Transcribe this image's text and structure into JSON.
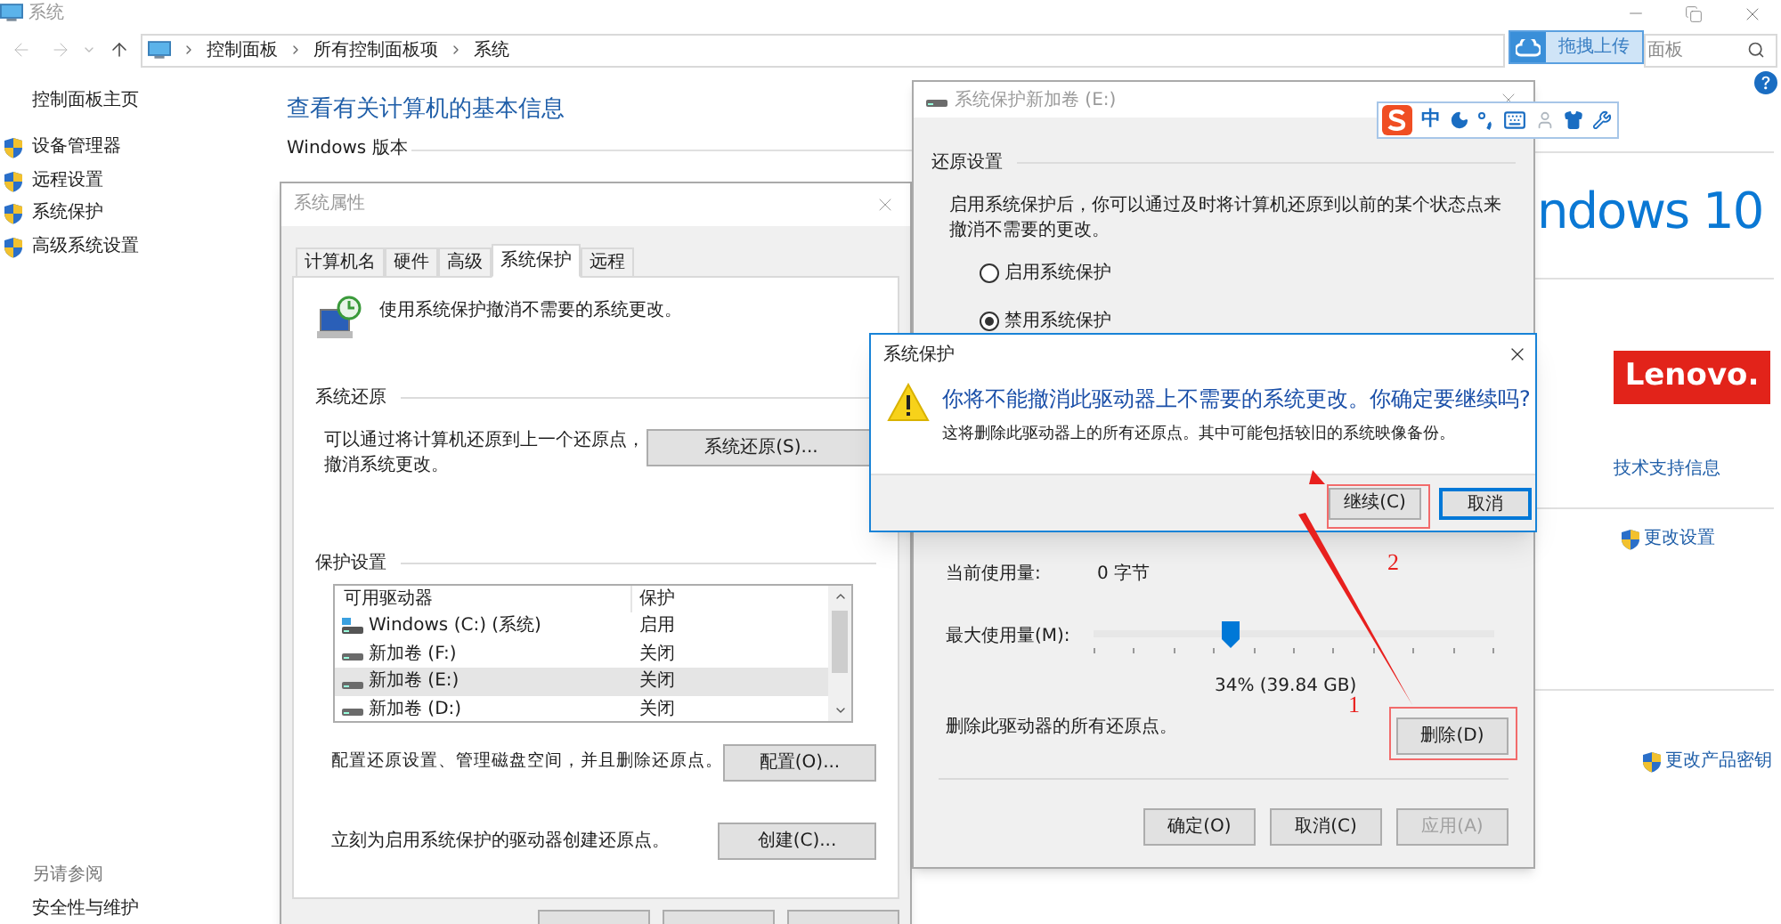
{
  "explorer": {
    "title": "系统",
    "crumbs": [
      "控制面板",
      "所有控制面板项",
      "系统"
    ],
    "search": {
      "placeholder": "面板"
    },
    "sidebar": {
      "home": "控制面板主页",
      "items": [
        "设备管理器",
        "远程设置",
        "系统保护",
        "高级系统设置"
      ],
      "see_also_title": "另请参阅",
      "see_also_items": [
        "安全性与维护"
      ]
    },
    "main": {
      "heading": "查看有关计算机的基本信息",
      "section_label": "Windows 版本",
      "windows_logo": "ndows 10",
      "oem_logo": "Lenovo.",
      "support_link": "技术支持信息",
      "change_settings": "更改设置",
      "change_key": "更改产品密钥"
    }
  },
  "upload_widget": {
    "label": "拖拽上传"
  },
  "system_properties": {
    "title": "系统属性",
    "tabs": [
      {
        "label": "计算机名",
        "selected": false
      },
      {
        "label": "硬件",
        "selected": false
      },
      {
        "label": "高级",
        "selected": false
      },
      {
        "label": "系统保护",
        "selected": true
      },
      {
        "label": "远程",
        "selected": false
      }
    ],
    "intro": "使用系统保护撤消不需要的系统更改。",
    "restore_group": {
      "title": "系统还原",
      "text": "可以通过将计算机还原到上一个还原点，撤消系统更改。",
      "button": "系统还原(S)..."
    },
    "protection_group": {
      "title": "保护设置",
      "columns": [
        "可用驱动器",
        "保护"
      ],
      "rows": [
        {
          "kind": "system",
          "drive": "Windows (C:) (系统)",
          "protection": "启用",
          "selected": false
        },
        {
          "kind": "volume",
          "drive": "新加卷 (F:)",
          "protection": "关闭",
          "selected": false
        },
        {
          "kind": "volume",
          "drive": "新加卷 (E:)",
          "protection": "关闭",
          "selected": true
        },
        {
          "kind": "volume",
          "drive": "新加卷 (D:)",
          "protection": "关闭",
          "selected": false
        }
      ],
      "configure_text": "配置还原设置、管理磁盘空间，并且删除还原点。",
      "configure_button": "配置(O)...",
      "create_text": "立刻为启用系统保护的驱动器创建还原点。",
      "create_button": "创建(C)..."
    }
  },
  "protection_dialog": {
    "title": "系统保护新加卷 (E:)",
    "restore_settings": "还原设置",
    "description": "启用系统保护后，你可以通过及时将计算机还原到以前的某个状态点来撤消不需要的更改。",
    "radios": [
      {
        "label": "启用系统保护",
        "selected": false
      },
      {
        "label": "禁用系统保护",
        "selected": true
      }
    ],
    "usage_label": "当前使用量:",
    "usage_value": "0 字节",
    "max_label": "最大使用量(M):",
    "slider": {
      "level": 0.34,
      "reading": "34% (39.84 GB)"
    },
    "delete_text": "删除此驱动器的所有还原点。",
    "delete_button": "删除(D)",
    "buttons": [
      {
        "label": "确定(O)",
        "disabled": false
      },
      {
        "label": "取消(C)",
        "disabled": false
      },
      {
        "label": "应用(A)",
        "disabled": true
      }
    ]
  },
  "ime_toolbar": {
    "mode": "中"
  },
  "alert": {
    "title": "系统保护",
    "instruction": "你将不能撤消此驱动器上不需要的系统更改。你确定要继续吗?",
    "detail": "这将删除此驱动器上的所有还原点。其中可能包括较旧的系统映像备份。",
    "buttons": [
      {
        "label": "继续(C)",
        "default": false
      },
      {
        "label": "取消",
        "default": true
      }
    ]
  },
  "annotations": [
    {
      "text": "1"
    },
    {
      "text": "2"
    }
  ]
}
